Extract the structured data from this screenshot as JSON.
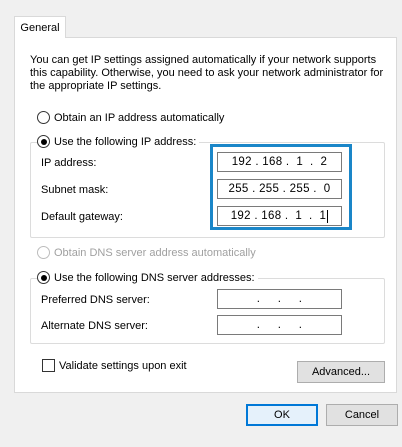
{
  "tab": {
    "general_label": "General"
  },
  "description": "You can get IP settings assigned automatically if your network supports this capability. Otherwise, you need to ask your network administrator for the appropriate IP settings.",
  "ip_section": {
    "obtain_auto_label": "Obtain an IP address automatically",
    "use_following_label": "Use the following IP address:",
    "ip_address_label": "IP address:",
    "ip_address_value": "192 . 168 .  1  .  2",
    "subnet_label": "Subnet mask:",
    "subnet_value": "255 . 255 . 255 .  0",
    "gateway_label": "Default gateway:",
    "gateway_value": "192 . 168 .  1  .  1"
  },
  "dns_section": {
    "obtain_auto_label": "Obtain DNS server address automatically",
    "use_following_label": "Use the following DNS server addresses:",
    "preferred_label": "Preferred DNS server:",
    "preferred_value": "  .     .     .  ",
    "alternate_label": "Alternate DNS server:",
    "alternate_value": "  .     .     .  "
  },
  "validate_label": "Validate settings upon exit",
  "buttons": {
    "advanced": "Advanced...",
    "ok": "OK",
    "cancel": "Cancel"
  },
  "colors": {
    "highlight": "#1a86c8",
    "ok_border": "#0078d7"
  }
}
